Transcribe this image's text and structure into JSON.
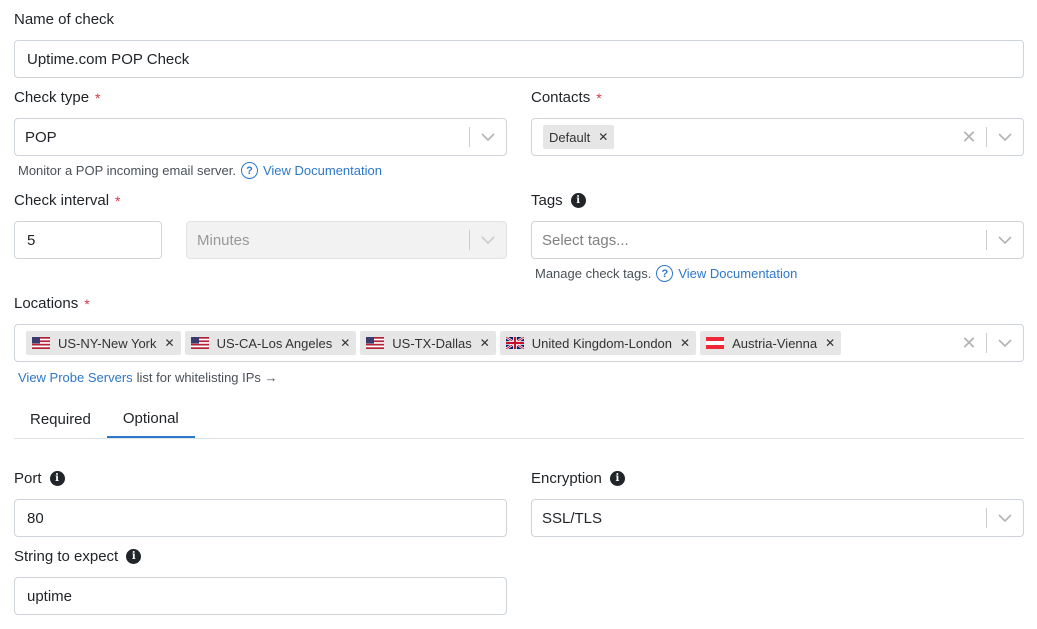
{
  "name": {
    "label": "Name of check",
    "value": "Uptime.com POP Check"
  },
  "check_type": {
    "label": "Check type",
    "required_mark": "*",
    "value": "POP",
    "help_text": "Monitor a POP incoming email server.",
    "help_link": "View Documentation"
  },
  "contacts": {
    "label": "Contacts",
    "required_mark": "*",
    "chips": [
      "Default"
    ]
  },
  "interval": {
    "label": "Check interval",
    "required_mark": "*",
    "value": "5",
    "unit": "Minutes"
  },
  "tags": {
    "label": "Tags",
    "placeholder": "Select tags...",
    "help_text": "Manage check tags.",
    "help_link": "View Documentation"
  },
  "locations": {
    "label": "Locations",
    "required_mark": "*",
    "chips": [
      {
        "name": "US-NY-New York",
        "flag": "us"
      },
      {
        "name": "US-CA-Los Angeles",
        "flag": "us"
      },
      {
        "name": "US-TX-Dallas",
        "flag": "us"
      },
      {
        "name": "United Kingdom-London",
        "flag": "uk"
      },
      {
        "name": "Austria-Vienna",
        "flag": "at"
      }
    ],
    "probe_link": "View Probe Servers",
    "probe_text": "list for whitelisting IPs →"
  },
  "tabs": {
    "required": "Required",
    "optional": "Optional",
    "active": "Optional"
  },
  "port": {
    "label": "Port",
    "value": "80"
  },
  "encryption": {
    "label": "Encryption",
    "value": "SSL/TLS"
  },
  "expect": {
    "label": "String to expect",
    "value": "uptime"
  },
  "icons": {
    "info": "info-icon",
    "help": "question-circle-icon",
    "chevron": "chevron-down-icon",
    "clear": "close-icon"
  },
  "colors": {
    "link": "#2c78c9",
    "required": "#dc3545",
    "border": "#ced4da"
  }
}
